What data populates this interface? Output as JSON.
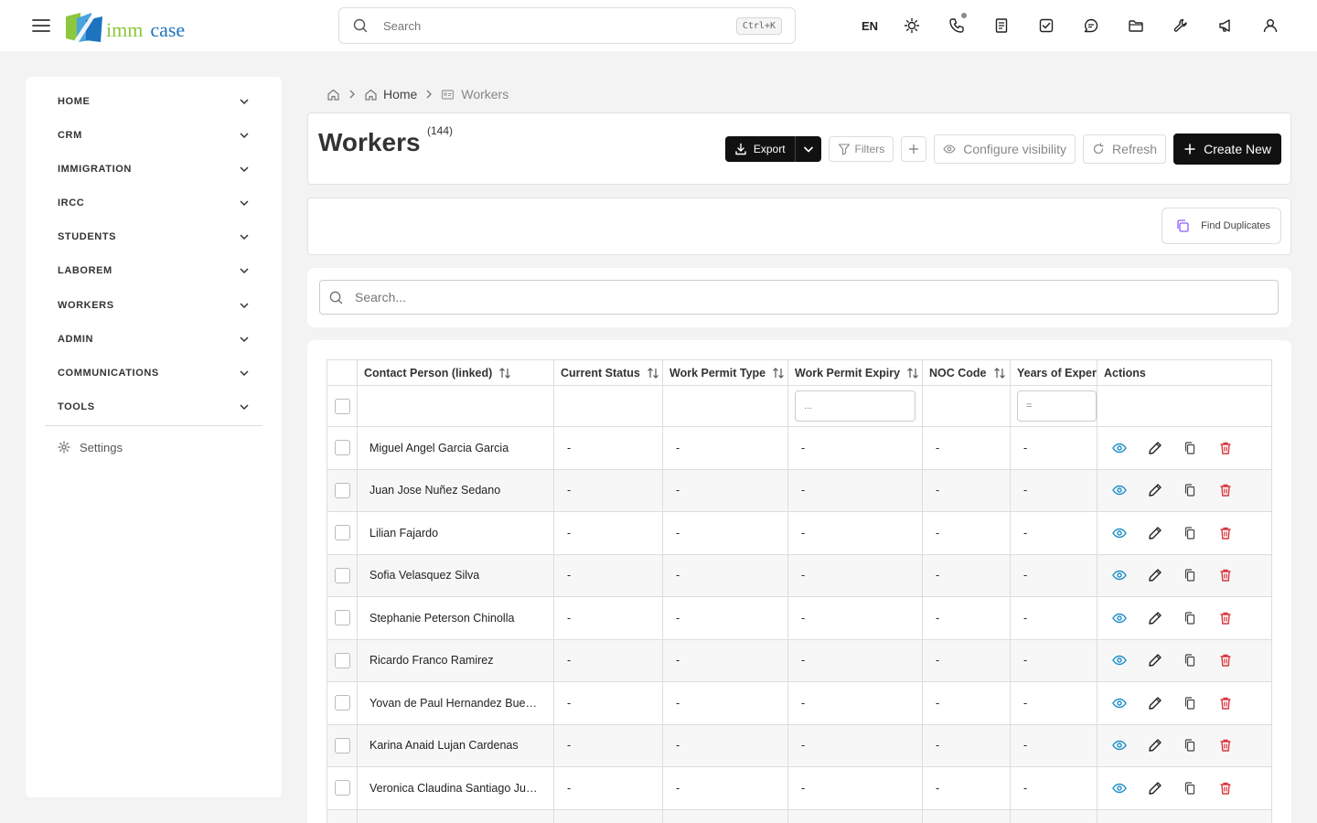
{
  "app": {
    "logo_imm": "imm",
    "logo_case": "case"
  },
  "topbar": {
    "search_placeholder": "Search",
    "shortcut": "Ctrl+K",
    "language": "EN",
    "icons": [
      "sun-icon",
      "phone-icon",
      "notes-icon",
      "tasks-icon",
      "chat-icon",
      "folder-icon",
      "tools-icon",
      "megaphone-icon",
      "user-icon"
    ]
  },
  "sidebar": {
    "items": [
      {
        "label": "HOME"
      },
      {
        "label": "CRM"
      },
      {
        "label": "IMMIGRATION"
      },
      {
        "label": "IRCC"
      },
      {
        "label": "STUDENTS"
      },
      {
        "label": "LABOREM"
      },
      {
        "label": "WORKERS"
      },
      {
        "label": "ADMIN"
      },
      {
        "label": "COMMUNICATIONS"
      },
      {
        "label": "TOOLS"
      }
    ],
    "settings_label": "Settings"
  },
  "breadcrumb": {
    "home": "Home",
    "current": "Workers"
  },
  "page": {
    "title": "Workers",
    "count": "(144)"
  },
  "toolbar": {
    "export": "Export",
    "filters": "Filters",
    "configure_visibility": "Configure visibility",
    "refresh": "Refresh",
    "create_new": "Create New"
  },
  "duplicates": {
    "label": "Find Duplicates"
  },
  "table_search": {
    "placeholder": "Search..."
  },
  "table": {
    "columns": [
      "Contact Person (linked)",
      "Current Status",
      "Work Permit Type",
      "Work Permit Expiry",
      "NOC Code",
      "Years of Experi",
      "Actions"
    ],
    "filters": {
      "expiry": "...",
      "years": "="
    },
    "rows": [
      {
        "name": "Miguel Angel Garcia Garcia",
        "status": "-",
        "type": "-",
        "expiry": "-",
        "noc": "-",
        "years": "-"
      },
      {
        "name": "Juan Jose Nuñez Sedano",
        "status": "-",
        "type": "-",
        "expiry": "-",
        "noc": "-",
        "years": "-"
      },
      {
        "name": "Lilian Fajardo",
        "status": "-",
        "type": "-",
        "expiry": "-",
        "noc": "-",
        "years": "-"
      },
      {
        "name": "Sofia Velasquez Silva",
        "status": "-",
        "type": "-",
        "expiry": "-",
        "noc": "-",
        "years": "-"
      },
      {
        "name": "Stephanie Peterson Chinolla",
        "status": "-",
        "type": "-",
        "expiry": "-",
        "noc": "-",
        "years": "-"
      },
      {
        "name": "Ricardo Franco Ramirez",
        "status": "-",
        "type": "-",
        "expiry": "-",
        "noc": "-",
        "years": "-"
      },
      {
        "name": "Yovan de Paul Hernandez Bue…",
        "status": "-",
        "type": "-",
        "expiry": "-",
        "noc": "-",
        "years": "-"
      },
      {
        "name": "Karina Anaid Lujan Cardenas",
        "status": "-",
        "type": "-",
        "expiry": "-",
        "noc": "-",
        "years": "-"
      },
      {
        "name": "Veronica Claudina Santiago Ju…",
        "status": "-",
        "type": "-",
        "expiry": "-",
        "noc": "-",
        "years": "-"
      },
      {
        "name": "",
        "status": "",
        "type": "",
        "expiry": "",
        "noc": "",
        "years": ""
      }
    ]
  },
  "colors": {
    "accent_dark": "#111111",
    "view_icon": "#1e90c8",
    "delete_icon": "#d9363e",
    "logo_green": "#8dc63f",
    "logo_blue": "#1e73be"
  }
}
